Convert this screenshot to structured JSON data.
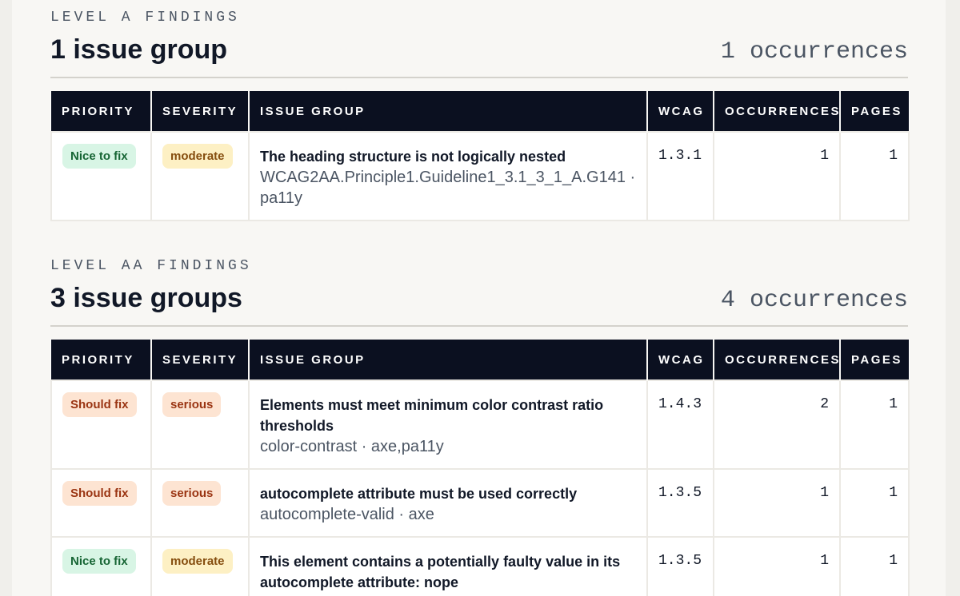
{
  "sections": [
    {
      "kicker": "LEVEL A FINDINGS",
      "title": "1 issue group",
      "occurrences_num": "1",
      "occurrences_label": "occurrences",
      "headers": [
        "PRIORITY",
        "SEVERITY",
        "ISSUE GROUP",
        "WCAG",
        "OCCURRENCES",
        "PAGES"
      ],
      "rows": [
        {
          "priority": "Nice to fix",
          "priority_kind": "nice",
          "severity": "moderate",
          "severity_kind": "moderate",
          "title": "The heading structure is not logically nested",
          "meta": "WCAG2AA.Principle1.Guideline1_3.1_3_1_A.G141 · pa11y",
          "wcag": "1.3.1",
          "occurrences": "1",
          "pages": "1"
        }
      ]
    },
    {
      "kicker": "LEVEL AA FINDINGS",
      "title": "3 issue groups",
      "occurrences_num": "4",
      "occurrences_label": "occurrences",
      "headers": [
        "PRIORITY",
        "SEVERITY",
        "ISSUE GROUP",
        "WCAG",
        "OCCURRENCES",
        "PAGES"
      ],
      "rows": [
        {
          "priority": "Should fix",
          "priority_kind": "should",
          "severity": "serious",
          "severity_kind": "serious",
          "title": "Elements must meet minimum color contrast ratio thresholds",
          "meta": "color-contrast · axe,pa11y",
          "wcag": "1.4.3",
          "occurrences": "2",
          "pages": "1"
        },
        {
          "priority": "Should fix",
          "priority_kind": "should",
          "severity": "serious",
          "severity_kind": "serious",
          "title": "autocomplete attribute must be used correctly",
          "meta": "autocomplete-valid · axe",
          "wcag": "1.3.5",
          "occurrences": "1",
          "pages": "1"
        },
        {
          "priority": "Nice to fix",
          "priority_kind": "nice",
          "severity": "moderate",
          "severity_kind": "moderate",
          "title": "This element contains a potentially faulty value in its autocomplete attribute: nope",
          "meta": "",
          "wcag": "1.3.5",
          "occurrences": "1",
          "pages": "1"
        }
      ]
    }
  ]
}
